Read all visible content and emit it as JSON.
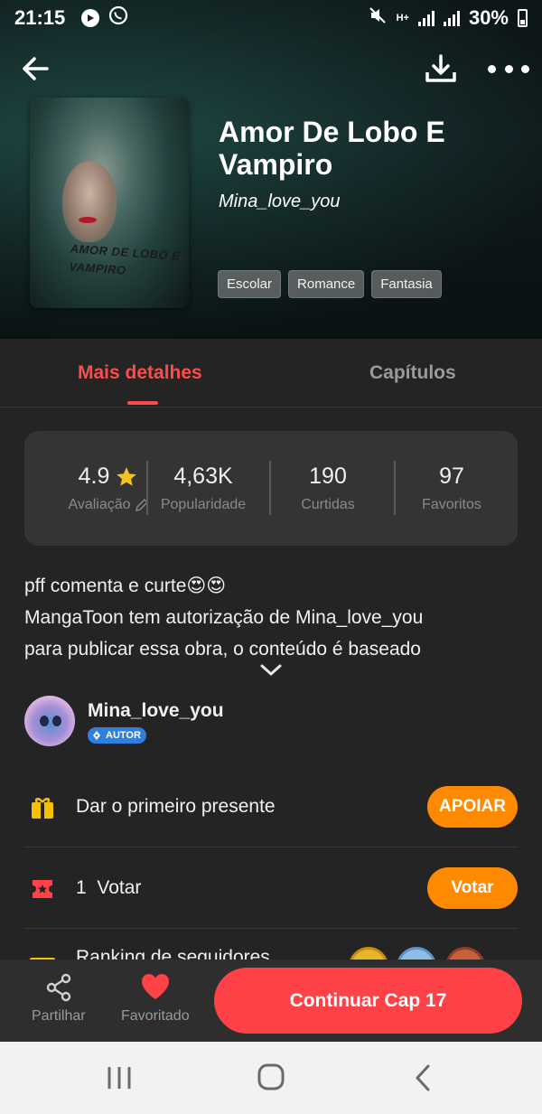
{
  "status_bar": {
    "time": "21:15",
    "battery": "30%",
    "network": "H+"
  },
  "book": {
    "title": "Amor De Lobo E Vampiro",
    "author": "Mina_love_you",
    "cover_text": "AMOR DE LOBO E VAMPIRO",
    "tags": [
      "Escolar",
      "Romance",
      "Fantasia"
    ]
  },
  "tabs": {
    "details": "Mais detalhes",
    "chapters": "Capítulos"
  },
  "stats": {
    "rating": {
      "value": "4.9",
      "label": "Avaliação"
    },
    "popularity": {
      "value": "4,63K",
      "label": "Popularidade"
    },
    "likes": {
      "value": "190",
      "label": "Curtidas"
    },
    "favorites": {
      "value": "97",
      "label": "Favoritos"
    }
  },
  "description": {
    "line1": "pff comenta e curte😍😍",
    "line2": "MangaToon tem autorização de Mina_love_you",
    "line3": "para publicar essa obra, o conteúdo é baseado"
  },
  "author": {
    "name": "Mina_love_you",
    "badge": "AUTOR"
  },
  "rows": {
    "gift_text": "Dar o primeiro presente",
    "gift_button": "APOIAR",
    "vote_count": "1",
    "vote_text": "Votar",
    "vote_button": "Votar",
    "ranking_text": "Ranking de seguidores"
  },
  "bottom_bar": {
    "share": "Partilhar",
    "favorited": "Favoritado",
    "continue": "Continuar Cap 17"
  },
  "colors": {
    "accent_red": "#ff4b4b",
    "accent_orange": "#ff8a00",
    "background": "#242424"
  }
}
